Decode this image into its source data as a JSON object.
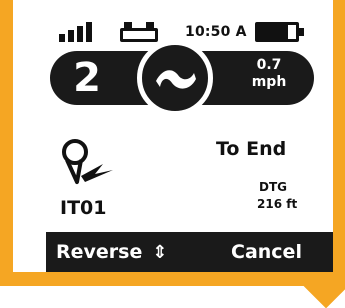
{
  "status": {
    "signal_bars": 4,
    "icon_cart": "cart-battery-icon",
    "time": "10:50 A",
    "battery_level": 0.8,
    "icon_battery": "battery-icon"
  },
  "dashboard": {
    "gear": "2",
    "compass_icon": "heading-arrow-icon",
    "speed_value": "0.7",
    "speed_unit": "mph"
  },
  "waypoint": {
    "icon": "waypoint-pin-icon",
    "name": "IT01"
  },
  "route": {
    "title": "To End",
    "dtg_label": "DTG",
    "dtg_value": "216 ft"
  },
  "softkeys": {
    "reverse_label": "Reverse",
    "reverse_icon": "up-down-arrow-icon",
    "reverse_glyph": "⇕",
    "cancel_label": "Cancel"
  },
  "colors": {
    "bezel": "#f5a623",
    "screen": "#ffffff",
    "dark": "#1a1a1a"
  }
}
